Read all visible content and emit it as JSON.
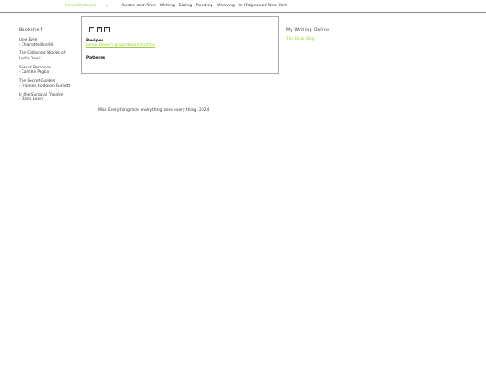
{
  "header": {
    "site_name": "Dana Wetwood",
    "separator_icon": "chevron-down-icon",
    "separator_glyph": "⌄",
    "tagline_prefix": "Awake and Alive",
    "tagline_rest": " - Writing - Eating - Reading - Weaving - In ",
    "tagline_place": "Ridgewood New York",
    "accent_color": "#9ccf3a"
  },
  "bookshelf": {
    "heading": "Bookshelf",
    "books": [
      {
        "title": "Jane Eyre",
        "author": "- Charlotte Brontë"
      },
      {
        "title": "The Collected Stories of Lydia Davis",
        "author": ""
      },
      {
        "title": "Sexual Personae",
        "author": "- Camille Paglia"
      },
      {
        "title": "The Secret Garden",
        "author": "- Frances Hodgson Burnett"
      },
      {
        "title": "In the Surgical Theatre",
        "author": "- Dana Levin"
      }
    ]
  },
  "main": {
    "nav_icons": [
      {
        "name": "prev-icon",
        "glyph": "‹"
      },
      {
        "name": "home-icon",
        "glyph": "•"
      },
      {
        "name": "next-icon",
        "glyph": "›"
      }
    ],
    "recipes_heading": "Recipes",
    "recipes_link": "Jamie Oliver's gingerbread muffins",
    "patterns_heading": "Patterns"
  },
  "footer": {
    "text": "Miss Everything miss everything miss every thing. 2024"
  },
  "online": {
    "heading": "My Writing Online",
    "link": "The Dusk Blog"
  }
}
